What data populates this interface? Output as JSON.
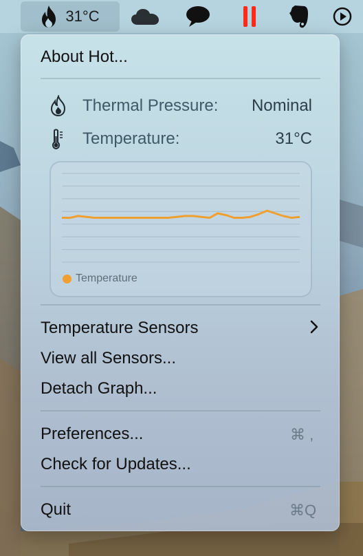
{
  "menubar": {
    "hot_temp": "31°C",
    "icons": [
      "flame-icon",
      "cloud-icon",
      "speech-bubble-icon",
      "pause-icon",
      "elephant-icon",
      "play-circle-icon"
    ],
    "pause_color": "#ff2a1a"
  },
  "menu": {
    "about": "About Hot...",
    "thermal_label": "Thermal Pressure:",
    "thermal_value": "Nominal",
    "temp_label": "Temperature:",
    "temp_value": "31°C",
    "graph_legend": "Temperature",
    "sensors": "Temperature Sensors",
    "view_all": "View all Sensors...",
    "detach": "Detach Graph...",
    "preferences": "Preferences...",
    "preferences_shortcut": "⌘ ,",
    "updates": "Check for Updates...",
    "quit": "Quit",
    "quit_shortcut": "⌘Q"
  },
  "chart_data": {
    "type": "line",
    "series": [
      {
        "name": "Temperature",
        "values": [
          31,
          31,
          31.2,
          31.1,
          31,
          31,
          31,
          31,
          31,
          31,
          31,
          31,
          31,
          31,
          31.1,
          31.2,
          31.2,
          31.1,
          31,
          31.5,
          31.3,
          31,
          31,
          31.1,
          31.4,
          31.8,
          31.5,
          31.2,
          31,
          31.1
        ]
      }
    ],
    "ylim": [
      26,
      36
    ],
    "grid": true,
    "legend_position": "bottom-left",
    "color": "#f0a030"
  }
}
